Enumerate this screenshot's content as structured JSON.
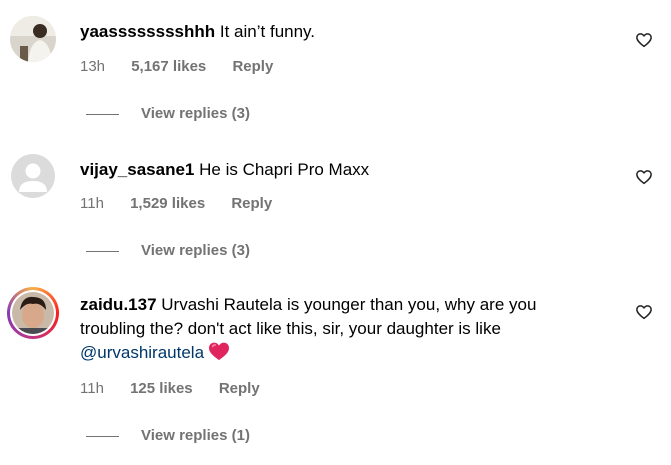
{
  "comments": [
    {
      "username": "yaasssssssshhh",
      "text": "It ain’t funny.",
      "time": "13h",
      "likes": "5,167 likes",
      "reply_label": "Reply",
      "view_replies": "View replies (3)",
      "avatar": "user-photo"
    },
    {
      "username": "vijay_sasane1",
      "text": "He is Chapri Pro Maxx",
      "time": "11h",
      "likes": "1,529 likes",
      "reply_label": "Reply",
      "view_replies": "View replies (3)",
      "avatar": "default-avatar"
    },
    {
      "username": "zaidu.137",
      "text": "Urvashi Rautela is younger than you, why are you troubling the? don't act like this, sir, your daughter is like",
      "mention": "@urvashirautela",
      "emoji": "red-heart",
      "time": "11h",
      "likes": "125 likes",
      "reply_label": "Reply",
      "view_replies": "View replies (1)",
      "avatar": "user-photo-story-ring"
    }
  ],
  "colors": {
    "secondary_text": "#737373",
    "mention": "#00376b",
    "heart": "#e0245e"
  },
  "icons": {
    "like": "heart-outline-icon"
  }
}
